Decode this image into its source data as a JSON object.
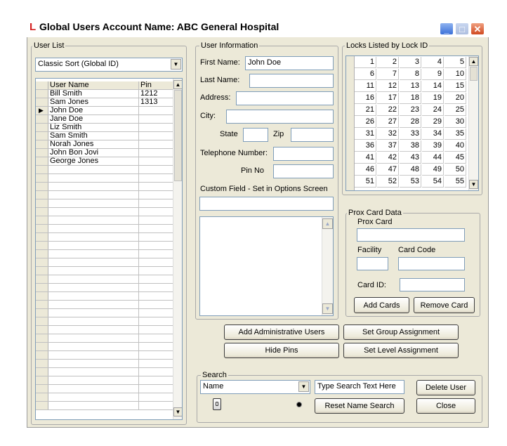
{
  "window": {
    "title": "Global Users Account Name: ABC General Hospital",
    "app_icon": "L",
    "minimize": "_",
    "maximize": "□",
    "close": "✕"
  },
  "user_list": {
    "label": "User List",
    "sort_value": "Classic Sort (Global ID)",
    "columns": [
      "User Name",
      "Pin"
    ],
    "rows": [
      {
        "name": "Bill Smith",
        "pin": "1212"
      },
      {
        "name": "Sam Jones",
        "pin": "1313"
      },
      {
        "name": "John Doe",
        "pin": ""
      },
      {
        "name": "Jane Doe",
        "pin": ""
      },
      {
        "name": "Liz Smith",
        "pin": ""
      },
      {
        "name": "Sam Smith",
        "pin": ""
      },
      {
        "name": "Norah Jones",
        "pin": ""
      },
      {
        "name": "John Bon Jovi",
        "pin": ""
      },
      {
        "name": "George Jones",
        "pin": ""
      }
    ],
    "current_marker": "▶"
  },
  "user_info": {
    "label": "User Information",
    "first_name_label": "First Name:",
    "first_name_value": "John Doe",
    "last_name_label": "Last Name:",
    "address_label": "Address:",
    "city_label": "City:",
    "state_label": "State",
    "zip_label": "Zip",
    "telephone_label": "Telephone Number:",
    "pin_label": "Pin No",
    "custom_field_label": "Custom Field - Set in Options Screen"
  },
  "locks": {
    "label": "Locks Listed by Lock ID",
    "rows": [
      [
        "1",
        "2",
        "3",
        "4",
        "5"
      ],
      [
        "6",
        "7",
        "8",
        "9",
        "10"
      ],
      [
        "11",
        "12",
        "13",
        "14",
        "15"
      ],
      [
        "16",
        "17",
        "18",
        "19",
        "20"
      ],
      [
        "21",
        "22",
        "23",
        "24",
        "25"
      ],
      [
        "26",
        "27",
        "28",
        "29",
        "30"
      ],
      [
        "31",
        "32",
        "33",
        "34",
        "35"
      ],
      [
        "36",
        "37",
        "38",
        "39",
        "40"
      ],
      [
        "41",
        "42",
        "43",
        "44",
        "45"
      ],
      [
        "46",
        "47",
        "48",
        "49",
        "50"
      ],
      [
        "51",
        "52",
        "53",
        "54",
        "55"
      ]
    ]
  },
  "prox": {
    "label": "Prox Card Data",
    "prox_card_label": "Prox Card",
    "facility_label": "Facility",
    "card_code_label": "Card Code",
    "card_id_label": "Card ID:",
    "add_cards": "Add Cards",
    "remove_card": "Remove Card"
  },
  "actions": {
    "add_admin": "Add Administrative Users",
    "set_group": "Set Group Assignment",
    "hide_pins": "Hide Pins",
    "set_level": "Set Level Assignment"
  },
  "search": {
    "label": "Search",
    "field_value": "Name",
    "text_value": "Type Search Text Here",
    "reset": "Reset Name Search",
    "delete_user": "Delete User",
    "close": "Close"
  }
}
